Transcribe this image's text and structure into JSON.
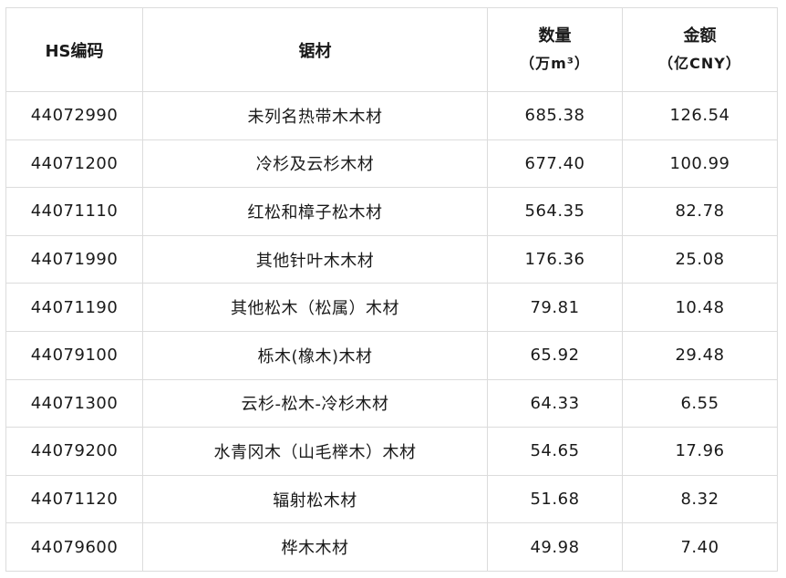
{
  "table": {
    "headers": {
      "hs_code": "HS编码",
      "lumber": "锯材",
      "quantity": "数量",
      "quantity_unit": "（万m³）",
      "amount": "金额",
      "amount_unit": "（亿CNY）"
    },
    "rows": [
      {
        "hs_code": "44072990",
        "lumber": "未列名热带木木材",
        "quantity": "685.38",
        "amount": "126.54"
      },
      {
        "hs_code": "44071200",
        "lumber": "冷杉及云杉木材",
        "quantity": "677.40",
        "amount": "100.99"
      },
      {
        "hs_code": "44071110",
        "lumber": "红松和樟子松木材",
        "quantity": "564.35",
        "amount": "82.78"
      },
      {
        "hs_code": "44071990",
        "lumber": "其他针叶木木材",
        "quantity": "176.36",
        "amount": "25.08"
      },
      {
        "hs_code": "44071190",
        "lumber": "其他松木（松属）木材",
        "quantity": "79.81",
        "amount": "10.48"
      },
      {
        "hs_code": "44079100",
        "lumber": "栎木(橡木)木材",
        "quantity": "65.92",
        "amount": "29.48"
      },
      {
        "hs_code": "44071300",
        "lumber": "云杉-松木-冷杉木材",
        "quantity": "64.33",
        "amount": "6.55"
      },
      {
        "hs_code": "44079200",
        "lumber": "水青冈木（山毛榉木）木材",
        "quantity": "54.65",
        "amount": "17.96"
      },
      {
        "hs_code": "44071120",
        "lumber": "辐射松木材",
        "quantity": "51.68",
        "amount": "8.32"
      },
      {
        "hs_code": "44079600",
        "lumber": "桦木木材",
        "quantity": "49.98",
        "amount": "7.40"
      }
    ]
  }
}
